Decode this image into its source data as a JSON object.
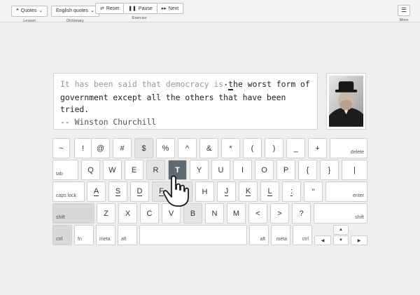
{
  "toolbar": {
    "lesson": {
      "label": "Quotes",
      "caption": "Lesson"
    },
    "dictionary": {
      "label": "English quotes",
      "caption": "Dictionary"
    },
    "exercise": {
      "reset": "Reset",
      "pause": "Pause",
      "next": "Next",
      "caption": "Exercise"
    },
    "more": {
      "caption": "More"
    }
  },
  "quote": {
    "typed": "It has been said that democracy is",
    "current": "t",
    "pending_first": "he worst form of",
    "pending_second": "government except all the others that have been tried.",
    "author": "-- Winston Churchill"
  },
  "keyboard": {
    "row1": [
      "~",
      "!",
      "@",
      "#",
      "$",
      "%",
      "^",
      "&",
      "*",
      "(",
      ")",
      "_",
      "+"
    ],
    "delete": "delete",
    "tab": "tab",
    "row2": [
      "Q",
      "W",
      "E",
      "R",
      "T",
      "Y",
      "U",
      "I",
      "O",
      "P",
      "{",
      "}",
      "|"
    ],
    "caps": "caps lock",
    "row3": [
      "A",
      "S",
      "D",
      "F",
      "G",
      "H",
      "J",
      "K",
      "L",
      ":",
      "\""
    ],
    "enter": "enter",
    "shift_left": "shift",
    "row4": [
      "Z",
      "X",
      "C",
      "V",
      "B",
      "N",
      "M",
      "<",
      ">",
      "?"
    ],
    "shift_right": "shift",
    "ctrl_left": "ctrl",
    "fn": "fn",
    "meta_left": "meta",
    "alt_left": "alt",
    "alt_right": "alt",
    "meta_right": "meta",
    "ctrl_right": "ctrl",
    "arrows": {
      "up": "▲",
      "left": "◀",
      "down": "▼",
      "right": "▶"
    }
  },
  "colors": {
    "active_key": "#5f6b73",
    "cursor": "#c0392b"
  }
}
